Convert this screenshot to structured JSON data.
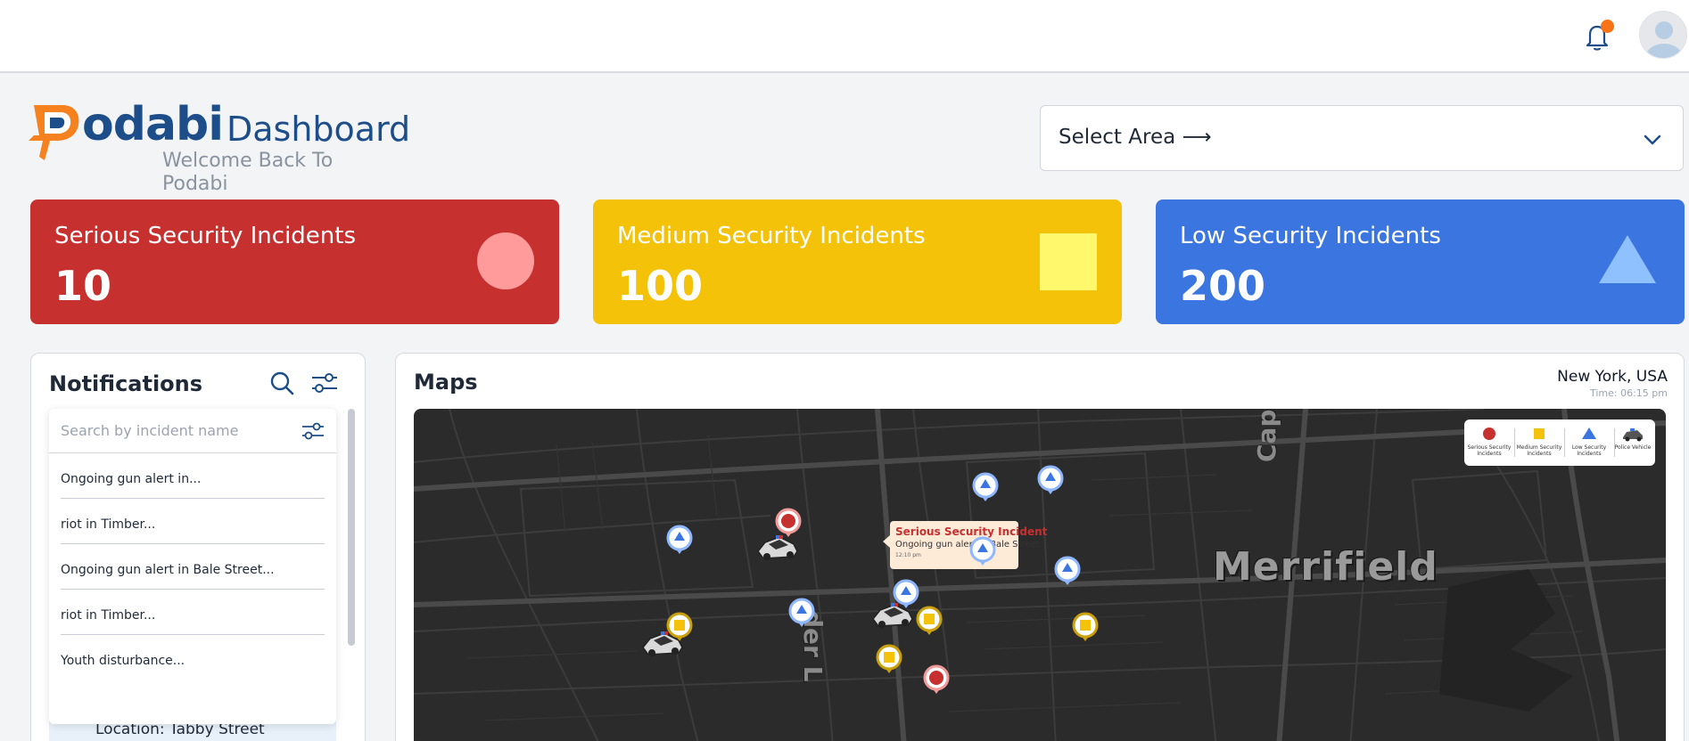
{
  "topbar": {
    "notification_icon": "bell-icon",
    "avatar_icon": "user-avatar",
    "notification_dot_color": "#f97316"
  },
  "brand": {
    "logo_word": "odabi",
    "dashboard_label": "Dashboard",
    "welcome": "Welcome Back To Podabi",
    "logo_color": "#1d4e89",
    "accent_color": "#f5821f"
  },
  "area_select": {
    "label": "Select Area ⟶",
    "icon": "chevron-down-icon"
  },
  "stats": [
    {
      "title": "Serious Security Incidents",
      "value": "10",
      "color": "#c6302f",
      "shape": "circle"
    },
    {
      "title": "Medium Security Incidents",
      "value": "100",
      "color": "#f5c20a",
      "shape": "square"
    },
    {
      "title": "Low Security Incidents",
      "value": "200",
      "color": "#3b76e0",
      "shape": "triangle"
    }
  ],
  "notifications": {
    "title": "Notifications",
    "search_placeholder": "Search by incident name",
    "items": [
      "Ongoing gun alert in...",
      "riot in Timber...",
      "Ongoing gun alert in Bale Street...",
      "riot in Timber...",
      "Youth disturbance..."
    ],
    "background_item_location": "Location: Tabby Street"
  },
  "maps": {
    "title": "Maps",
    "location": "New York, USA",
    "time": "Time: 06:15 pm",
    "district_label": "Merrifield",
    "street_label_vertical": "der L",
    "street_label_cap": "Cap",
    "legend": [
      {
        "label": "Serious Security Incidents",
        "icon": "red-circle"
      },
      {
        "label": "Medium Security Incidents",
        "icon": "yellow-square"
      },
      {
        "label": "Low Security Incidents",
        "icon": "blue-triangle"
      },
      {
        "label": "Police Vehicle",
        "icon": "police-car-icon"
      }
    ],
    "tooltip": {
      "title": "Serious Security Incident",
      "body": "Ongoing gun alert in Bale Street.",
      "time": "12:10 pm"
    }
  }
}
